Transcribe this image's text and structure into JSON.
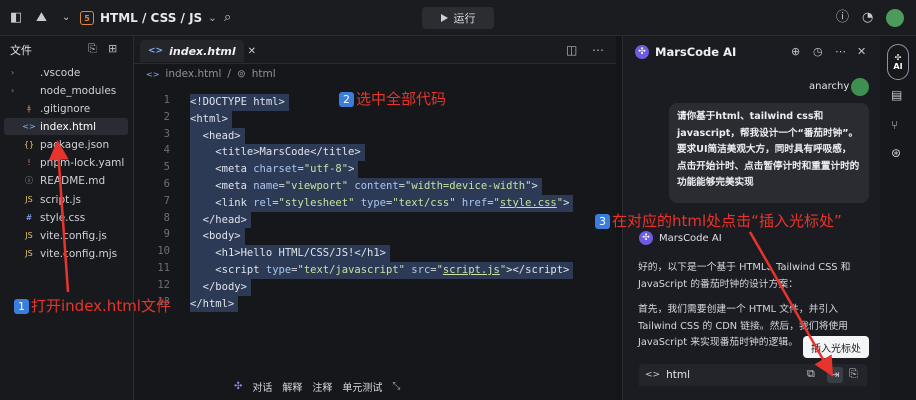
{
  "topbar": {
    "project_name": "HTML / CSS / JS",
    "project_badge": "5",
    "run_label": "运行"
  },
  "explorer": {
    "title": "文件",
    "items": [
      {
        "name": ".vscode",
        "type": "folder",
        "icon": "›"
      },
      {
        "name": "node_modules",
        "type": "folder",
        "icon": "›"
      },
      {
        "name": ".gitignore",
        "type": "file",
        "icon": "ǂ"
      },
      {
        "name": "index.html",
        "type": "file",
        "icon": "<>"
      },
      {
        "name": "package.json",
        "type": "file",
        "icon": "{}"
      },
      {
        "name": "pnpm-lock.yaml",
        "type": "file",
        "icon": "!"
      },
      {
        "name": "README.md",
        "type": "file",
        "icon": "ⓘ"
      },
      {
        "name": "script.js",
        "type": "file",
        "icon": "JS"
      },
      {
        "name": "style.css",
        "type": "file",
        "icon": "#"
      },
      {
        "name": "vite.config.js",
        "type": "file",
        "icon": "JS"
      },
      {
        "name": "vite.config.mjs",
        "type": "file",
        "icon": "JS"
      }
    ]
  },
  "editor": {
    "tab_label": "index.html",
    "breadcrumb": [
      "index.html",
      "html"
    ],
    "line_numbers": [
      "1",
      "2",
      "3",
      "4",
      "5",
      "6",
      "7",
      "8",
      "9",
      "10",
      "11",
      "12",
      "13"
    ],
    "inline_actions": [
      "对话",
      "解释",
      "注释",
      "单元测试"
    ]
  },
  "annotations": {
    "step1": "打开index.html文件",
    "step2": "选中全部代码",
    "step3": "在对应的html处点击“插入光标处”",
    "n1": "1",
    "n2": "2",
    "n3": "3"
  },
  "ai_panel": {
    "title": "MarsCode AI",
    "user_name": "anarchy",
    "user_message": "请你基于html、tailwind css和javascript，帮我设计一个“番茄时钟”。要求UI简洁美观大方，同时具有呼吸感，点击开始计时、点击暂停计时和重置计时的功能能够完美实现",
    "bot_name": "MarsCode AI",
    "reply_1": "好的，以下是一个基于 HTML、Tailwind CSS 和 JavaScript 的番茄时钟的设计方案：",
    "reply_2": "首先，我们需要创建一个 HTML 文件，并引入 Tailwind CSS 的 CDN 链接。然后，我们将使用 JavaScript 来实现番茄时钟的逻辑。",
    "insert_tooltip": "插入光标处",
    "code_block_lang": "html"
  },
  "rail": {
    "ai_label": "AI"
  }
}
